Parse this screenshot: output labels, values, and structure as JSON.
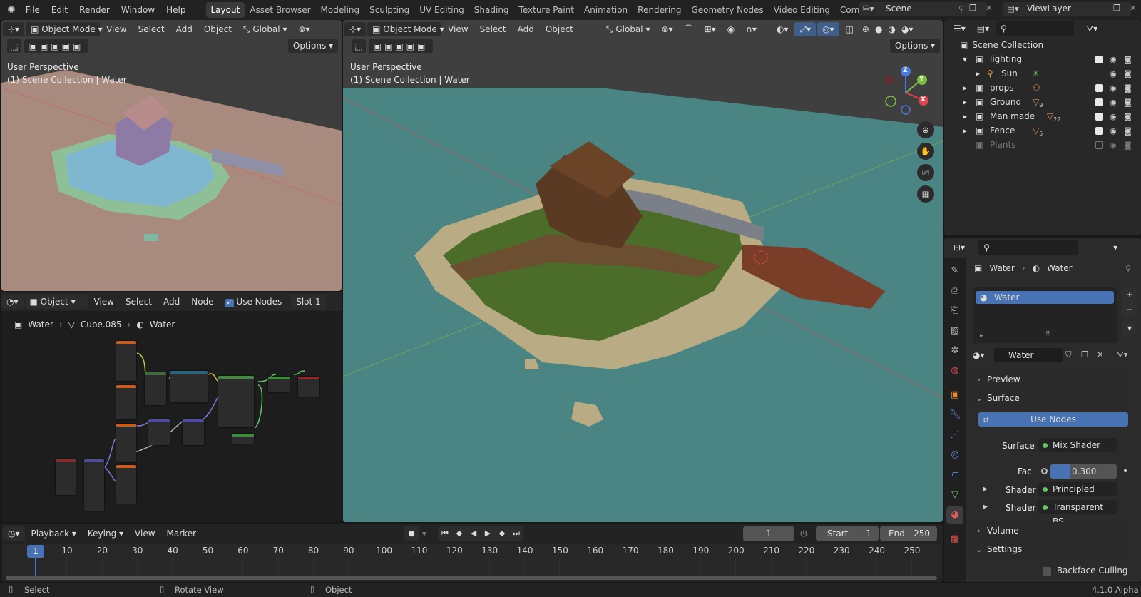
{
  "topbar": {
    "menus": [
      "File",
      "Edit",
      "Render",
      "Window",
      "Help"
    ],
    "tabs": [
      "Layout",
      "Asset Browser",
      "Modeling",
      "Sculpting",
      "UV Editing",
      "Shading",
      "Texture Paint",
      "Animation",
      "Rendering",
      "Geometry Nodes",
      "Video Editing",
      "Compositin"
    ],
    "active_tab": "Layout",
    "scene": "Scene",
    "view_layer": "ViewLayer"
  },
  "left_viewport": {
    "mode": "Object Mode",
    "menus": [
      "View",
      "Select",
      "Add",
      "Object"
    ],
    "orientation": "Global",
    "options": "Options",
    "perspective": "User Perspective",
    "collection": "(1) Scene Collection | Water"
  },
  "main_viewport": {
    "mode": "Object Mode",
    "menus": [
      "View",
      "Select",
      "Add",
      "Object"
    ],
    "orientation": "Global",
    "options": "Options",
    "perspective": "User Perspective",
    "collection": "(1) Scene Collection | Water",
    "gizmo": {
      "z": "Z",
      "y": "Y",
      "x": "X"
    }
  },
  "node_editor": {
    "type": "Object",
    "menus": [
      "View",
      "Select",
      "Add",
      "Node"
    ],
    "use_nodes": "Use Nodes",
    "slot": "Slot 1",
    "breadcrumb": [
      "Water",
      "Cube.085",
      "Water"
    ]
  },
  "outliner": {
    "root": "Scene Collection",
    "items": [
      {
        "name": "lighting",
        "count": ""
      },
      {
        "name": "Sun",
        "count": ""
      },
      {
        "name": "props",
        "count": ""
      },
      {
        "name": "Ground",
        "count": "9"
      },
      {
        "name": "Man made",
        "count": "22"
      },
      {
        "name": "Fence",
        "count": "5"
      },
      {
        "name": "Plants",
        "count": ""
      }
    ]
  },
  "properties": {
    "breadcrumb": [
      "Water",
      "Water"
    ],
    "slot_item": "Water",
    "material_name": "Water",
    "sections": {
      "preview": "Preview",
      "surface": "Surface",
      "volume": "Volume",
      "settings": "Settings"
    },
    "use_nodes": "Use Nodes",
    "surface_label": "Surface",
    "surface_value": "Mix Shader",
    "fac_label": "Fac",
    "fac_value": "0.300",
    "fac_fraction": 0.3,
    "shader1_label": "Shader",
    "shader1_value": "Principled BSDF",
    "shader2_label": "Shader",
    "shader2_value": "Transparent BS...",
    "backface": "Backface Culling"
  },
  "timeline": {
    "menus": [
      "Playback",
      "Keying",
      "View",
      "Marker"
    ],
    "current_frame": "1",
    "start_label": "Start",
    "start": "1",
    "end_label": "End",
    "end": "250",
    "ticks": [
      "1",
      "10",
      "20",
      "30",
      "40",
      "50",
      "60",
      "70",
      "80",
      "90",
      "100",
      "110",
      "120",
      "130",
      "140",
      "150",
      "160",
      "170",
      "180",
      "190",
      "200",
      "210",
      "220",
      "230",
      "240",
      "250"
    ]
  },
  "statusbar": {
    "select": "Select",
    "rotate": "Rotate View",
    "object": "Object",
    "version": "4.1.0 Alpha"
  }
}
